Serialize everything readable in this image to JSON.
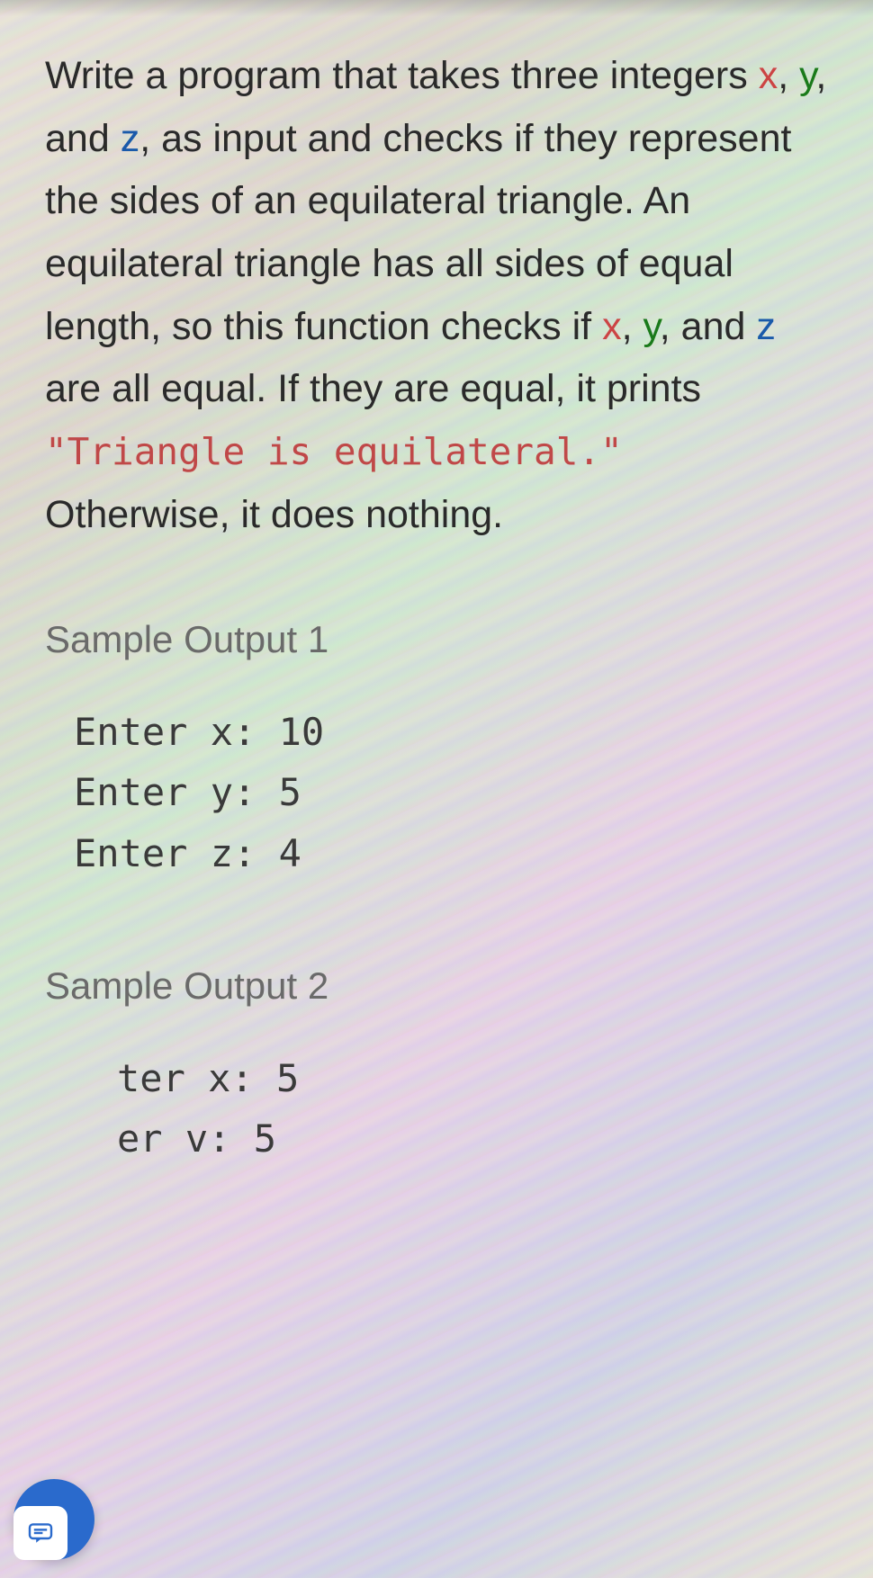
{
  "question": {
    "part1": "Write a program that takes three integers ",
    "var_x": "x",
    "comma1": ", ",
    "var_y": "y",
    "comma2": ", and ",
    "var_z": "z",
    "part2": ", as input and checks if they represent the sides of an equilateral triangle. An equilateral triangle has all sides of equal length, so this function checks if ",
    "var_x2": "x",
    "comma3": ", ",
    "var_y2": "y",
    "comma4": ", and ",
    "var_z2": "z",
    "part3": " are all equal. If they are equal, it prints ",
    "code_string": "\"Triangle is equilateral.\"",
    "part4": " Otherwise, it does nothing."
  },
  "sample1": {
    "heading": "Sample Output 1",
    "lines": [
      "Enter x: 10",
      "Enter y: 5",
      "Enter z: 4"
    ]
  },
  "sample2": {
    "heading": "Sample Output 2",
    "lines": [
      "ter x: 5",
      "er v: 5"
    ]
  }
}
